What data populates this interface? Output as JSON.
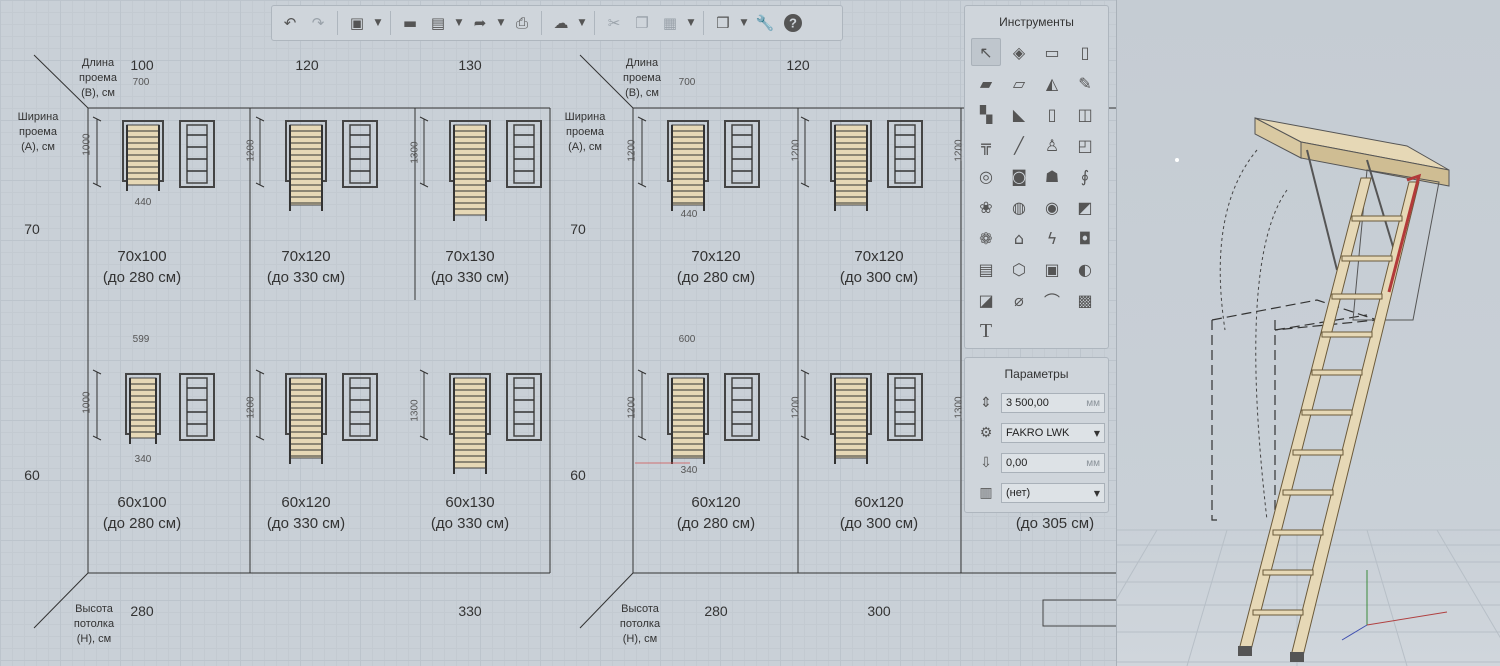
{
  "headers_left": {
    "length_label": "Длина\nпроема\n(B), см",
    "width_label": "Ширина\nпроема\n(А), см",
    "height_label": "Высота\nпотолка\n(Н), см",
    "lengths": [
      "100",
      "120",
      "130"
    ],
    "widths": [
      "70",
      "60"
    ],
    "heights": [
      "280",
      "330"
    ]
  },
  "headers_right": {
    "length_label": "Длина\nпроема\n(B), см",
    "width_label": "Ширина\nпроема\n(А), см",
    "height_label": "Высота\nпотолка\n(Н), см",
    "lengths": [
      "120"
    ],
    "widths": [
      "70",
      "60"
    ],
    "heights": [
      "280",
      "300"
    ]
  },
  "cells_left": [
    {
      "size": "70x100",
      "height": "(до 280 см)",
      "dim_top": "700",
      "dim_side": "1000",
      "dim_bottom": "440"
    },
    {
      "size": "70x120",
      "height": "(до 330 см)",
      "dim_side": "1200"
    },
    {
      "size": "70x130",
      "height": "(до 330 см)",
      "dim_side": "1300"
    },
    {
      "size": "60x100",
      "height": "(до 280 см)",
      "dim_top": "599",
      "dim_side": "1000",
      "dim_bottom": "340"
    },
    {
      "size": "60x120",
      "height": "(до 330 см)",
      "dim_side": "1200"
    },
    {
      "size": "60x130",
      "height": "(до 330 см)",
      "dim_side": "1300"
    }
  ],
  "cells_right": [
    {
      "size": "70x120",
      "height": "(до 280 см)",
      "dim_top": "700",
      "dim_side": "1200",
      "dim_bottom": "440"
    },
    {
      "size": "70x120",
      "height": "(до 300 см)",
      "dim_side": "1200"
    },
    {
      "size": "60x120",
      "height": "(до 280 см)",
      "dim_top": "600",
      "dim_side": "1200",
      "dim_bottom": "340"
    },
    {
      "size": "60x120",
      "height": "(до 300 см)",
      "dim_side": "1200"
    }
  ],
  "partial_text": {
    "right_edge_height": "(до 305 см)",
    "right_edge_dim": "1300"
  },
  "toolbar": {
    "buttons": [
      "undo-icon",
      "redo-icon",
      "3d-object-icon",
      "open-folder-icon",
      "save-icon",
      "export-icon",
      "print-icon",
      "render-icon",
      "cut-icon",
      "copy-icon",
      "paste-icon",
      "views-icon",
      "settings-wrench-icon",
      "help-icon"
    ]
  },
  "tools_panel": {
    "title": "Инструменты",
    "tools": [
      "select",
      "3d-shapes",
      "wall",
      "column",
      "slab",
      "beam",
      "roof",
      "pencil",
      "stairs",
      "terrain",
      "door",
      "window",
      "railing",
      "line",
      "chair",
      "sofa",
      "table",
      "appliance",
      "lamp",
      "pipe",
      "plant",
      "washer",
      "pet",
      "misc",
      "bath",
      "house",
      "electric",
      "camera",
      "building",
      "shape-3d",
      "photo-frame",
      "rotate",
      "picture",
      "dimension",
      "curve",
      "texture",
      "text"
    ]
  },
  "params_panel": {
    "title": "Параметры",
    "height_value": "3 500,00",
    "height_unit": "мм",
    "model_value": "FAKRO LWK",
    "offset_value": "0,00",
    "offset_unit": "мм",
    "material_value": "(нет)"
  },
  "colors": {
    "background": "#c9d0d7",
    "panel": "#cfd5db",
    "line": "#333333",
    "ladder_wood": "#e6d8b6",
    "handrail": "#b23a3a"
  }
}
